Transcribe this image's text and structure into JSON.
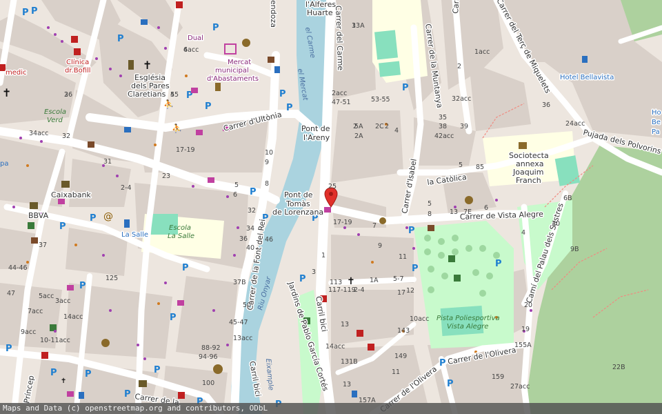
{
  "map": {
    "streets": {
      "carme": "Carrer del Carme",
      "font_del_rei": "Carrer de la Font del Rei",
      "ultonia": "Carrer d'Ultònia",
      "isabel": "Carrer d'Isabel la Catòlica",
      "vista_alegre": "Carrer de Vista Alegre",
      "montanya": "Carrer de la Muntanya",
      "sol": "Carrer del Sol",
      "terc": "Carrer del Terç de Miquelets",
      "polvorins": "Pujada dels Polvorins",
      "palau": "Camí del Palau dels Sastres",
      "olivera_1": "Carrer de l'Olivera",
      "olivera_2": "Carrer de l'Olivera",
      "carril_bici_1": "Carril bici",
      "carril_bici_2": "Carril bici",
      "princep": "Príncep",
      "carrer_de_la": "Carrer de la",
      "jardins": "Jardins de Pablo García Cortés",
      "alferes": "l'Alferes",
      "huarte": "Huarte",
      "endoza": "endoza"
    },
    "water": {
      "riu_onyar": "Riu Onyar",
      "carme_water": "el Carme",
      "mercat_water": "el Mercat",
      "eixample": "Eixample"
    },
    "bridges": {
      "areny_1": "Pont de",
      "areny_2": "l'Areny",
      "tomas_1": "Pont de",
      "tomas_2": "Tomàs",
      "tomas_3": "de Lorenzana"
    },
    "pois": {
      "mercat_1": "Mercat",
      "mercat_2": "municipal",
      "mercat_3": "d'Abastaments",
      "esglesia_1": "Església",
      "esglesia_2": "dels Pares",
      "esglesia_3": "Claretians",
      "clinica_1": "Clínica",
      "clinica_2": "dr.Bofill",
      "escola_verd_1": "Escola",
      "escola_verd_2": "Verd",
      "escola_salle_1": "Escola",
      "escola_salle_2": "La Salle",
      "la_salle": "La Salle",
      "caixabank": "Caixabank",
      "bbva": "BBVA",
      "dual": "Dual",
      "medic": "medic",
      "hotel": "Hotel Bellavista",
      "hotel_right_1": "Ho",
      "hotel_right_2": "Be",
      "hotel_right_3": "Pa",
      "sociotecta_1": "Sociotecta",
      "sociotecta_2": "annexa",
      "sociotecta_3": "Joaquim",
      "sociotecta_4": "Franch",
      "pista_1": "Pista Poliesportiva",
      "pista_2": "Vista Alegre",
      "left_pa": "pa"
    },
    "house_numbers": [
      "33A",
      "6acc",
      "45",
      "26",
      "34acc",
      "32",
      "31",
      "23",
      "2-4",
      "17-19",
      "10",
      "9",
      "5",
      "6",
      "8",
      "32",
      "34",
      "36",
      "46",
      "40",
      "37B",
      "50",
      "45-47",
      "13acc",
      "88-92",
      "94-96",
      "100",
      "125",
      "5acc",
      "3acc",
      "7acc",
      "14acc",
      "9acc",
      "10-11acc",
      "44-46",
      "47",
      "37",
      "1acc",
      "2",
      "32acc",
      "35",
      "38",
      "39",
      "42acc",
      "36",
      "24acc",
      "2acc",
      "47-51",
      "53-55",
      "5A",
      "2A",
      "2C",
      "2",
      "4",
      "6",
      "8",
      "13",
      "7E",
      "7",
      "9",
      "11",
      "1",
      "3",
      "113",
      "117-119",
      "1A",
      "2-4",
      "5-7",
      "12",
      "17",
      "10acc",
      "13",
      "14acc",
      "131B",
      "143",
      "149",
      "11",
      "13",
      "157A",
      "155A",
      "159",
      "27acc",
      "22B",
      "6B",
      "9B",
      "5",
      "19",
      "20",
      "25",
      "17-19",
      "85",
      "2",
      "20",
      "4",
      "5",
      "1",
      "4",
      "5",
      "3"
    ],
    "attribution": "Maps and Data (c) openstreetmap.org and contributors, ODbL",
    "colors": {
      "background": "#f2efe9",
      "building": "#d9d0c9",
      "road": "#ffffff",
      "river": "#aad3df",
      "park": "#c8facc",
      "pitch": "#88e0be",
      "wood": "#add19e",
      "school": "#ffffe5",
      "marker": "#e0302a",
      "parking": "#1f7fd0"
    }
  }
}
